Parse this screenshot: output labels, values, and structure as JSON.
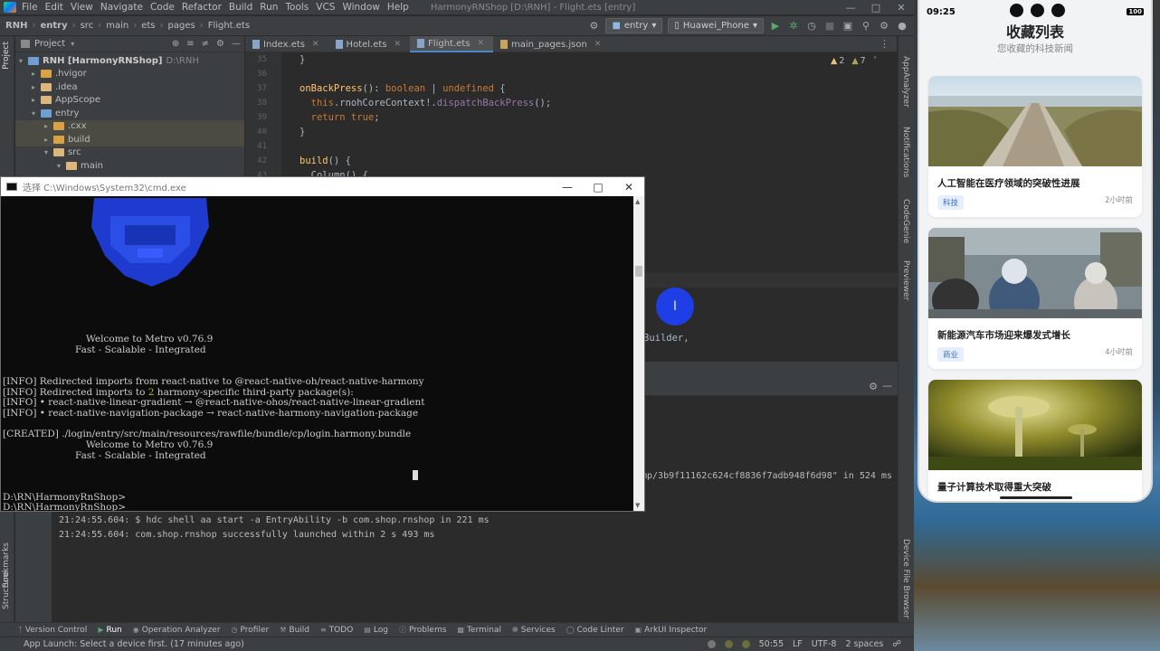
{
  "titlebar": {
    "menus": [
      "File",
      "Edit",
      "View",
      "Navigate",
      "Code",
      "Refactor",
      "Build",
      "Run",
      "Tools",
      "VCS",
      "Window",
      "Help"
    ],
    "window_title": "HarmonyRNShop [D:\\RNH] - Flight.ets [entry]"
  },
  "toolbar": {
    "breadcrumbs": [
      "RNH",
      "entry",
      "src",
      "main",
      "ets",
      "pages",
      "Flight.ets"
    ],
    "module": "entry",
    "device": "Huawei_Phone"
  },
  "project_panel": {
    "header": "Project",
    "items": [
      {
        "label": "RNH [HarmonyRNShop]",
        "suffix": "D:\\RNH"
      },
      {
        "label": ".hvigor"
      },
      {
        "label": ".idea"
      },
      {
        "label": "AppScope"
      },
      {
        "label": "entry"
      },
      {
        "label": ".cxx"
      },
      {
        "label": "build"
      },
      {
        "label": "src"
      },
      {
        "label": "main"
      }
    ]
  },
  "editor": {
    "tabs": [
      "Index.ets",
      "Hotel.ets",
      "Flight.ets",
      "main_pages.json"
    ],
    "active_tab": "Flight.ets",
    "line_numbers": [
      "35",
      "36",
      "37",
      "38",
      "39",
      "40",
      "41",
      "42",
      "43"
    ],
    "warnings": {
      "warn": "2",
      "weak": "7"
    },
    "code": {
      "l35": "}",
      "l37_fn": "onBackPress",
      "l37_rest": "(): ",
      "l37_type1": "boolean",
      "l37_pipe": " | ",
      "l37_type2": "undefined",
      "l37_brace": " {",
      "l38_this": "this",
      "l38_rest": ".rnohCoreContext!.",
      "l38_call": "dispatchBackPress",
      "l38_end": "();",
      "l39_ret": "return ",
      "l39_val": "true",
      "l39_end": ";",
      "l40": "}",
      "l42_fn": "build",
      "l42_rest": "() {",
      "l43": "Column() {"
    },
    "fragment": "Builder,"
  },
  "run_panel": {
    "fragment": "mp/3b9f11162c624cf8836f7adb948f6d98\" in 524 ms",
    "lines": [
      "21:24:55.604: $ hdc shell aa start -a EntryAbility -b com.shop.rnshop in 221 ms",
      "21:24:55.604: com.shop.rnshop successfully launched within 2 s 493 ms"
    ]
  },
  "right_stripe": [
    "AppAnalyzer",
    "Notifications",
    "CodeGenie",
    "Previewer",
    "Device File Browser"
  ],
  "left_stripe": [
    "Project",
    "Bookmarks",
    "Structure"
  ],
  "bottom_tools": [
    "Version Control",
    "Run",
    "Operation Analyzer",
    "Profiler",
    "Build",
    "TODO",
    "Log",
    "Problems",
    "Terminal",
    "Services",
    "Code Linter",
    "ArkUI Inspector"
  ],
  "statusbar": {
    "message": "App Launch: Select a device first. (17 minutes ago)",
    "position": "50:55",
    "line_sep": "LF",
    "encoding": "UTF-8",
    "indent": "2 spaces"
  },
  "cmd": {
    "title": "选择 C:\\Windows\\System32\\cmd.exe",
    "welcome1": "Welcome to Metro",
    "version1": "v0.76.9",
    "tagline1": "Fast - Scalable - Integrated",
    "l1a": "[INFO] Redirected imports from ",
    "l1b": "react-native",
    "l1c": " to @react-native-oh/react-native-harmony",
    "l2a": "[INFO] Redirected imports to ",
    "l2b": "2",
    "l2c": " harmony-specific third-party package(s):",
    "l3a": "[INFO] • ",
    "l3b": "react-native-linear-gradient",
    "l3c": " → @react-native-ohos/react-native-linear-gradient",
    "l4a": "[INFO] • ",
    "l4b": "react-native-navigation-package",
    "l4c": " → react-native-harmony-navigation-package",
    "created": "[CREATED] ./login/entry/src/main/resources/rawfile/bundle/cp/login.harmony.bundle",
    "welcome2": "Welcome to Metro",
    "version2": "v0.76.9",
    "tagline2": "Fast - Scalable - Integrated",
    "prompt1": "D:\\RN\\HarmonyRnShop>",
    "prompt2": "D:\\RN\\HarmonyRnShop>"
  },
  "phone": {
    "time": "09:25",
    "battery": "100",
    "title": "收藏列表",
    "subtitle": "您收藏的科技新闻",
    "cards": [
      {
        "title": "人工智能在医疗领域的突破性进展",
        "tag": "科技",
        "time": "2小时前"
      },
      {
        "title": "新能源汽车市场迎来爆发式增长",
        "tag": "商业",
        "time": "4小时前"
      },
      {
        "title": "量子计算技术取得重大突破"
      }
    ]
  }
}
